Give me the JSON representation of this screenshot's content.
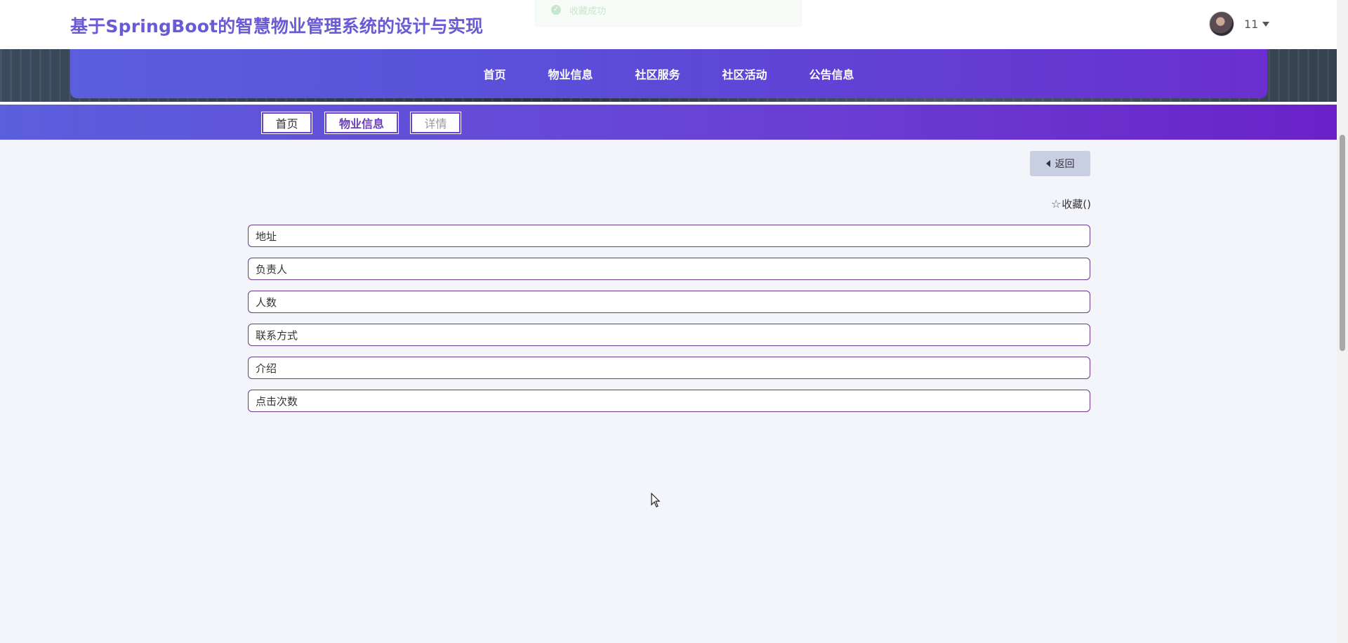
{
  "header": {
    "title": "基于SpringBoot的智慧物业管理系统的设计与实现",
    "toast_text": "收藏成功",
    "user_name": "11"
  },
  "nav": {
    "items": [
      {
        "label": "首页"
      },
      {
        "label": "物业信息"
      },
      {
        "label": "社区服务"
      },
      {
        "label": "社区活动"
      },
      {
        "label": "公告信息"
      }
    ]
  },
  "breadcrumb": {
    "items": [
      {
        "label": "首页"
      },
      {
        "label": "物业信息"
      },
      {
        "label": "详情"
      }
    ]
  },
  "actions": {
    "back_label": "返回",
    "favorite_label": "收藏()"
  },
  "fields": [
    {
      "label": "地址"
    },
    {
      "label": "负责人"
    },
    {
      "label": "人数"
    },
    {
      "label": "联系方式"
    },
    {
      "label": "介绍"
    },
    {
      "label": "点击次数"
    }
  ],
  "colors": {
    "accent": "#6a5ad6",
    "nav_start": "#5b5fdc",
    "nav_end": "#6a22c8",
    "field_border": "#6a3a8a"
  }
}
